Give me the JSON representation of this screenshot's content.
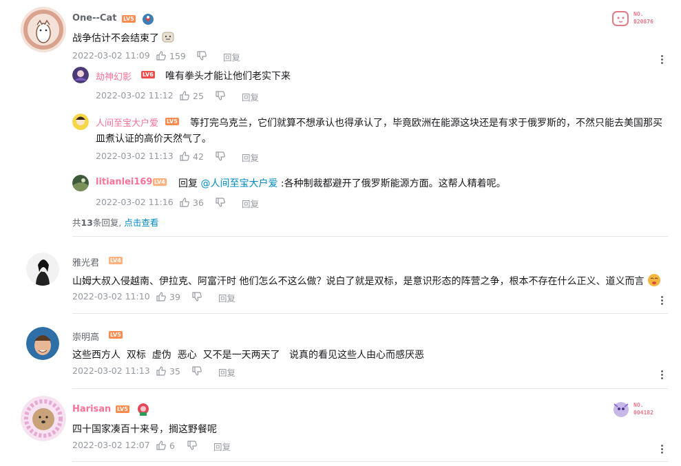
{
  "colors": {
    "username_default": "#61666d",
    "username_vip": "#fb7299",
    "text": "#18191c",
    "meta": "#9499a0",
    "link": "#008ac5",
    "divider": "#e3e5e7"
  },
  "comments": [
    {
      "user": "One--Cat",
      "level": "LV5",
      "content": "战争估计不会结束了",
      "time": "2022-03-02 11:09",
      "likes": "159",
      "reply_label": "回复",
      "fan_badge": {
        "line1": "NO.",
        "line2": "020876"
      },
      "replies": [
        {
          "user": "劫神幻影",
          "level": "LV6",
          "content": "唯有拳头才能让他们老实下来",
          "time": "2022-03-02 11:12",
          "likes": "25",
          "reply_label": "回复"
        },
        {
          "user": "人间至宝大户爱",
          "level": "LV5",
          "content_line1": "等打完乌克兰，它们就算不想承认也得承认了，毕竟欧洲在能源这块还是有求于俄罗斯的，不然只能去美国那买",
          "content_line2": "皿煮认证的高价天然气了。",
          "time": "2022-03-02 11:13",
          "likes": "42",
          "reply_label": "回复"
        },
        {
          "user": "litianlei169",
          "level": "LV4",
          "reply_prefix": "回复",
          "mention": "@人间至宝大户爱",
          "content": ":各种制裁都避开了俄罗斯能源方面。这帮人精着呢。",
          "time": "2022-03-02 11:16",
          "likes": "36",
          "reply_label": "回复"
        }
      ],
      "reply_summary": {
        "prefix": "共",
        "count": "13",
        "suffix": "条回复,",
        "view_more": "点击查看"
      }
    },
    {
      "user": "雅光君",
      "level": "LV4",
      "content": "山姆大叔入侵越南、伊拉克、阿富汗时 他们怎么不这么做？说白了就是双标，是意识形态的阵营之争，根本不存在什么正义、道义而言",
      "time": "2022-03-02 11:10",
      "likes": "39",
      "reply_label": "回复"
    },
    {
      "user": "崇明高",
      "level": "LV5",
      "content": "这些西方人  双标  虚伪  恶心  又不是一天两天了   说真的看见这些人由心而感厌恶",
      "time": "2022-03-02 11:13",
      "likes": "35",
      "reply_label": "回复"
    },
    {
      "user": "Harisan",
      "level": "LV5",
      "content": "四十国家凑百十来号，搁这野餐呢",
      "time": "2022-03-02 12:07",
      "likes": "6",
      "reply_label": "回复",
      "fan_badge": {
        "line1": "NO.",
        "line2": "004182"
      }
    }
  ]
}
